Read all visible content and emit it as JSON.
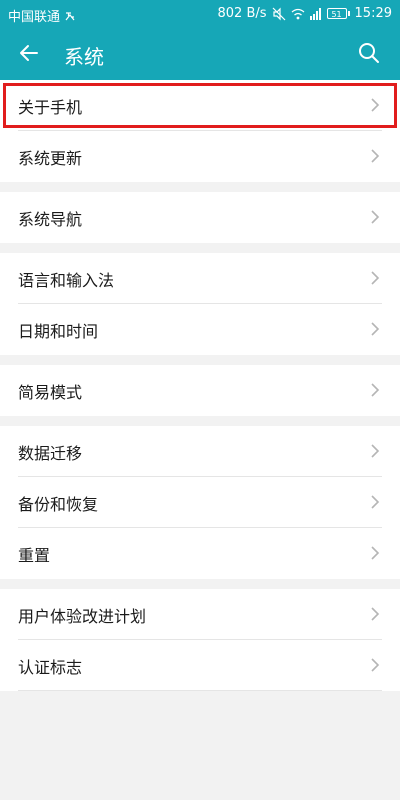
{
  "statusbar": {
    "carrier": "中国联通",
    "network_speed": "802 B/s",
    "battery_level": "51",
    "time": "15:29"
  },
  "header": {
    "title": "系统"
  },
  "groups": [
    {
      "items": [
        {
          "label": "关于手机",
          "highlighted": true
        },
        {
          "label": "系统更新"
        }
      ]
    },
    {
      "items": [
        {
          "label": "系统导航"
        }
      ]
    },
    {
      "items": [
        {
          "label": "语言和输入法"
        },
        {
          "label": "日期和时间"
        }
      ]
    },
    {
      "items": [
        {
          "label": "简易模式"
        }
      ]
    },
    {
      "items": [
        {
          "label": "数据迁移"
        },
        {
          "label": "备份和恢复"
        },
        {
          "label": "重置"
        }
      ]
    },
    {
      "items": [
        {
          "label": "用户体验改进计划"
        },
        {
          "label": "认证标志"
        }
      ]
    }
  ],
  "colors": {
    "accent": "#16a7b7",
    "highlight_border": "#e11d1d",
    "background": "#f2f2f2"
  },
  "icons": [
    "back-arrow-icon",
    "search-icon",
    "chevron-right-icon",
    "wifi-icon",
    "mute-icon",
    "signal-icon",
    "battery-icon",
    "sim-icon"
  ]
}
